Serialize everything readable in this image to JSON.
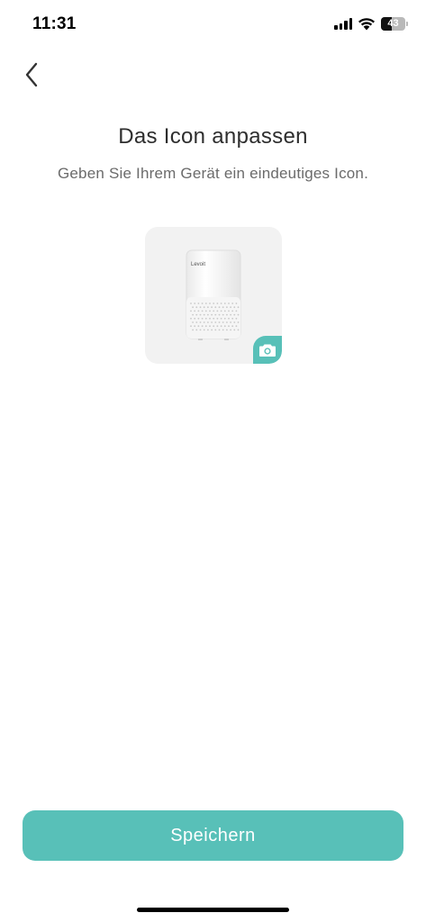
{
  "status_bar": {
    "time": "11:31",
    "battery_level": "43",
    "battery_fraction": 0.43
  },
  "header": {
    "title": "Das Icon anpassen",
    "subtitle": "Geben Sie Ihrem Gerät ein eindeutiges Icon."
  },
  "device": {
    "brand_label": "Levoit"
  },
  "icons": {
    "back": "chevron-left-icon",
    "camera": "camera-icon",
    "signal": "cellular-signal-icon",
    "wifi": "wifi-icon",
    "battery": "battery-icon"
  },
  "footer": {
    "save_label": "Speichern"
  },
  "colors": {
    "accent": "#58c0b8",
    "card_background": "#f2f2f2",
    "title_text": "#2e2e2e",
    "subtitle_text": "#6b6b6b"
  }
}
